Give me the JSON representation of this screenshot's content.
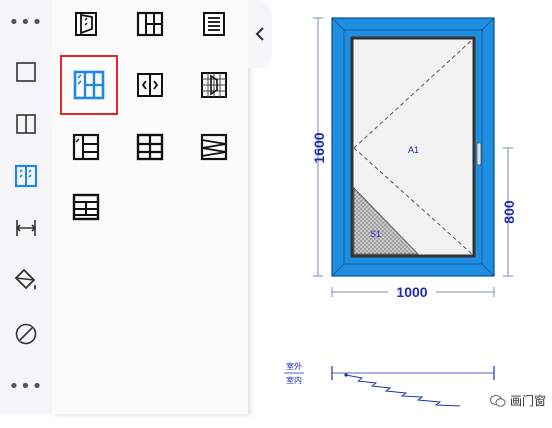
{
  "rail": {
    "items": [
      {
        "icon": "more-dots-icon",
        "glyph": "•••"
      },
      {
        "icon": "single-pane-icon"
      },
      {
        "icon": "split-pane-icon"
      },
      {
        "icon": "sash-window-icon",
        "active": true
      },
      {
        "icon": "dimension-icon"
      },
      {
        "icon": "paint-bucket-icon"
      },
      {
        "icon": "diagonal-circle-icon"
      },
      {
        "icon": "more-dots-icon",
        "glyph": "•••"
      }
    ],
    "active_color": "#1e88e5"
  },
  "palette": {
    "tiles": [
      "hinged-sash-icon",
      "grid-sash-icon",
      "louver-icon",
      "double-sash-icon",
      "sliding-arrows-icon",
      "mesh-grid-icon",
      "mixed-sash-icon",
      "cross-grid-icon",
      "zigzag-mesh-icon",
      "cross-bar-icon"
    ],
    "selected_index": 3,
    "selection_color": "#e0262b"
  },
  "drawing": {
    "height_label": "1600",
    "width_label": "1000",
    "lower_label": "800",
    "sash_label": "A1",
    "glass_label": "S1",
    "outside_label": "室外",
    "inside_label": "室内",
    "frame_color": "#1e8fe0",
    "dimension_color": "#1c2bb8"
  },
  "watermark": "画门窗"
}
